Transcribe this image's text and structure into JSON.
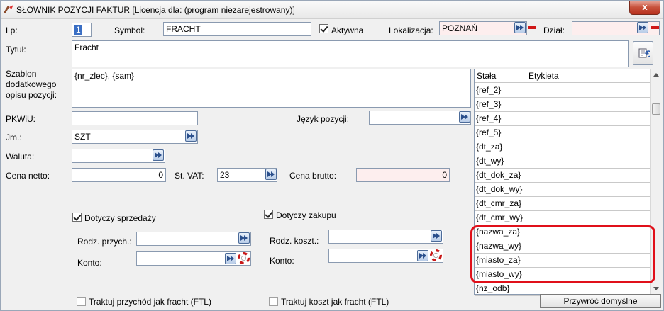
{
  "window": {
    "title": "SŁOWNIK POZYCJI FAKTUR  [Licencja dla: (program niezarejestrowany)]",
    "close_label": "x"
  },
  "form": {
    "lp_label": "Lp:",
    "lp_value": "1",
    "symbol_label": "Symbol:",
    "symbol_value": "FRACHT",
    "aktywna_label": "Aktywna",
    "lokalizacja_label": "Lokalizacja:",
    "lokalizacja_value": "POZNAŃ",
    "dzial_label": "Dział:",
    "dzial_value": "",
    "tytul_label": "Tytuł:",
    "tytul_value": "Fracht",
    "szablon_label": "Szablon\ndodatkowego\nopisu pozycji:",
    "szablon_value": "{nr_zlec}, {sam}",
    "pkwiu_label": "PKWiU:",
    "pkwiu_value": "",
    "jezyk_label": "Język pozycji:",
    "jezyk_value": "",
    "jm_label": "Jm.:",
    "jm_value": "SZT",
    "waluta_label": "Waluta:",
    "waluta_value": "",
    "cena_netto_label": "Cena netto:",
    "cena_netto_value": "0",
    "st_vat_label": "St. VAT:",
    "st_vat_value": "23",
    "cena_brutto_label": "Cena brutto:",
    "cena_brutto_value": "0",
    "sprzedaz_label": "Dotyczy sprzedaży",
    "zakup_label": "Dotyczy zakupu",
    "rodz_przych_label": "Rodz. przych.:",
    "rodz_przych_value": "",
    "rodz_koszt_label": "Rodz. koszt.:",
    "rodz_koszt_value": "",
    "konto_sprz_label": "Konto:",
    "konto_sprz_value": "",
    "konto_zak_label": "Konto:",
    "konto_zak_value": "",
    "traktuj_przychod_label": "Traktuj przychód jak fracht (FTL)",
    "traktuj_koszt_label": "Traktuj koszt jak fracht (FTL)"
  },
  "list": {
    "header_stala": "Stała",
    "header_etykieta": "Etykieta",
    "rows": [
      "{ref_2}",
      "{ref_3}",
      "{ref_4}",
      "{ref_5}",
      "{dt_za}",
      "{dt_wy}",
      "{dt_dok_za}",
      "{dt_dok_wy}",
      "{dt_cmr_za}",
      "{dt_cmr_wy}",
      "{nazwa_za}",
      "{nazwa_wy}",
      "{miasto_za}",
      "{miasto_wy}",
      "{nz_odb}"
    ],
    "reset_label": "Przywróć domyślne"
  },
  "colors": {
    "highlight": "#e0101a",
    "dropdown_arrow": "#2a4f8c",
    "clear_icon": "#d01818"
  }
}
